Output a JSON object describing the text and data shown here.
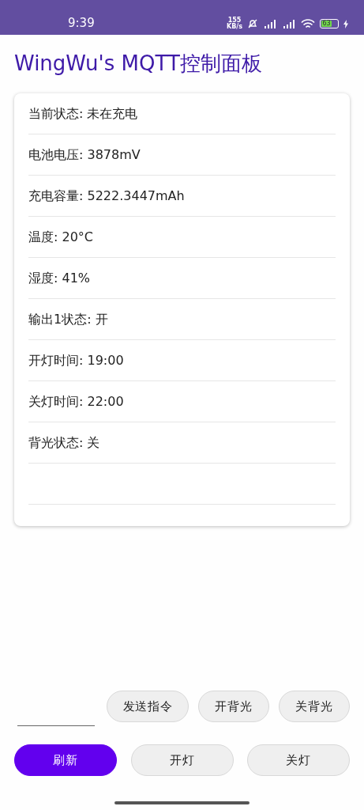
{
  "status_bar": {
    "time": "9:39",
    "speed_value": "155",
    "speed_unit": "KB/s",
    "battery": "63"
  },
  "title": "WingWu's MQTT控制面板",
  "status_rows": [
    "当前状态: 未在充电",
    "电池电压: 3878mV",
    "充电容量: 5222.3447mAh",
    "温度: 20°C",
    "湿度: 41%",
    "输出1状态: 开",
    "开灯时间: 19:00",
    "关灯时间: 22:00",
    "背光状态: 关"
  ],
  "command_buttons": [
    {
      "label": "发送指令",
      "kind": "secondary"
    },
    {
      "label": "开背光",
      "kind": "secondary"
    },
    {
      "label": "关背光",
      "kind": "secondary"
    }
  ],
  "action_buttons": [
    {
      "label": "刷新",
      "kind": "primary"
    },
    {
      "label": "开灯",
      "kind": "secondary"
    },
    {
      "label": "关灯",
      "kind": "secondary"
    }
  ]
}
